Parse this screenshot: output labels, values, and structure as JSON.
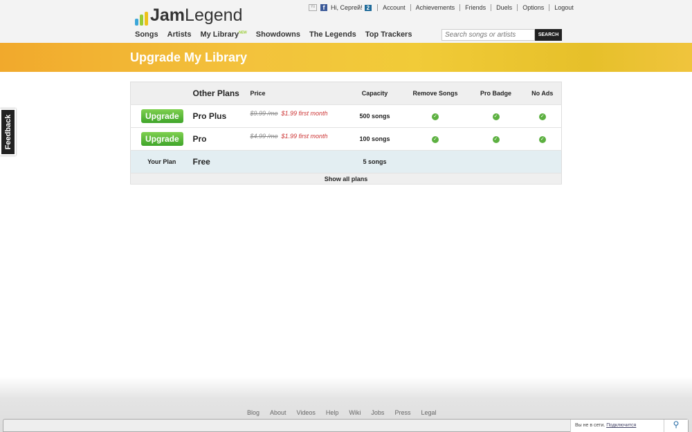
{
  "header": {
    "logo_bold": "Jam",
    "logo_rest": "Legend",
    "yo": "Yo",
    "greeting": "Hi, Cергей!",
    "badge_count": "2",
    "top_links": [
      "Account",
      "Achievements",
      "Friends",
      "Duels",
      "Options",
      "Logout"
    ],
    "nav": [
      "Songs",
      "Artists",
      "My Library",
      "Showdowns",
      "The Legends",
      "Top Trackers"
    ],
    "new_tag": "NEW",
    "search_placeholder": "Search songs or artists",
    "search_button": "SEARCH"
  },
  "banner": {
    "title": "Upgrade My Library"
  },
  "feedback": "Feedback",
  "table": {
    "headers": {
      "plans": "Other Plans",
      "price": "Price",
      "capacity": "Capacity",
      "remove_songs": "Remove Songs",
      "pro_badge": "Pro Badge",
      "no_ads": "No Ads"
    },
    "rows": [
      {
        "action": "Upgrade",
        "plan": "Pro Plus",
        "old_price": "$9.99 /mo",
        "new_price": "$1.99 first month",
        "capacity": "500 songs"
      },
      {
        "action": "Upgrade",
        "plan": "Pro",
        "old_price": "$4.99 /mo",
        "new_price": "$1.99 first month",
        "capacity": "100 songs"
      }
    ],
    "current": {
      "label": "Your Plan",
      "plan": "Free",
      "capacity": "5 songs"
    },
    "show_all": "Show all plans"
  },
  "footer": [
    "Blog",
    "About",
    "Videos",
    "Help",
    "Wiki",
    "Jobs",
    "Press",
    "Legal"
  ],
  "chat": {
    "status": "Вы не в сети.",
    "connect": "Подключится"
  }
}
